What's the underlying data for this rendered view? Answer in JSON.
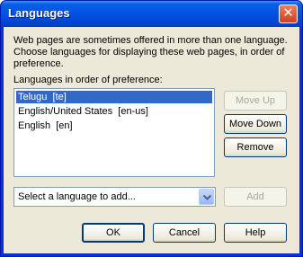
{
  "window": {
    "title": "Languages",
    "close_glyph": "✕"
  },
  "description": "Web pages are sometimes offered in more than one language. Choose languages for displaying these web pages, in order of preference.",
  "list_label": "Languages in order of preference:",
  "languages": [
    {
      "label": "Telugu  [te]",
      "selected": true
    },
    {
      "label": "English/United States  [en-us]",
      "selected": false
    },
    {
      "label": "English  [en]",
      "selected": false
    }
  ],
  "buttons": {
    "move_up": "Move Up",
    "move_down": "Move Down",
    "remove": "Remove",
    "add": "Add",
    "ok": "OK",
    "cancel": "Cancel",
    "help": "Help"
  },
  "select": {
    "value": "Select a language to add..."
  }
}
